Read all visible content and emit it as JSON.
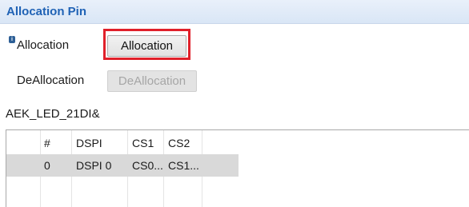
{
  "section": {
    "title": "Allocation Pin"
  },
  "info_badge": "i",
  "allocation": {
    "label": "Allocation",
    "button": "Allocation"
  },
  "deallocation": {
    "label": "DeAllocation",
    "button": "DeAllocation"
  },
  "device": {
    "label": "AEK_LED_21DI&"
  },
  "table": {
    "columns": [
      "#",
      "DSPI",
      "CS1",
      "CS2"
    ],
    "rows": [
      {
        "index": "0",
        "dspi": "DSPI 0",
        "cs1": "CS0...",
        "cs2": "CS1..."
      }
    ]
  },
  "colors": {
    "header_title": "#1f62b5",
    "highlight": "#e0202a",
    "selected_row": "#d9d9d9"
  }
}
